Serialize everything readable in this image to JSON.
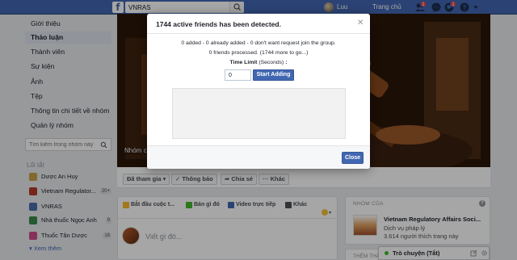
{
  "topbar": {
    "brand_color": "#4267b2",
    "logo_letter": "f",
    "search_value": "VNRAS",
    "user_name": "Luu",
    "home_label": "Trang chủ",
    "badges": {
      "friends": "1",
      "messages": "",
      "notifications": "1"
    }
  },
  "sidebar": {
    "items": [
      {
        "label": "Giới thiệu",
        "active": false
      },
      {
        "label": "Thảo luận",
        "active": true
      },
      {
        "label": "Thành viên",
        "active": false
      },
      {
        "label": "Sự kiện",
        "active": false
      },
      {
        "label": "Ảnh",
        "active": false
      },
      {
        "label": "Tệp",
        "active": false
      },
      {
        "label": "Thông tin chi tiết về nhóm",
        "active": false
      },
      {
        "label": "Quản lý nhóm",
        "active": false
      }
    ],
    "search_placeholder": "Tìm kiếm trong nhóm này",
    "shortcuts_heading": "Lối tắt",
    "shortcuts": [
      {
        "label": "Dược An Huy",
        "count": "",
        "color": "#c8a24a"
      },
      {
        "label": "Vietnam Regulator...",
        "count": "20+",
        "color": "#b43a2a"
      },
      {
        "label": "VNRAS",
        "count": "",
        "color": "#4a6ab0"
      },
      {
        "label": "Nhà thuốc Ngọc Anh",
        "count": "9",
        "color": "#3a8a4a"
      },
      {
        "label": "Thuốc Tân Dược",
        "count": "18",
        "color": "#d04a8a"
      }
    ],
    "see_more": "Xem thêm"
  },
  "cover": {
    "name_partial": "Nhóm c"
  },
  "action_bar": {
    "joined": "Đã tham gia",
    "notifications": "Thông báo",
    "share": "Chia sẻ",
    "more": "Khác"
  },
  "composer": {
    "tabs": [
      "Bắt đầu cuộc t...",
      "Bán gì đó",
      "Video trực tiếp",
      "Khác"
    ],
    "placeholder": "Viết gì đó..."
  },
  "right_panel": {
    "heading": "NHÓM CỦA",
    "group_title": "Vietnam Regulatory Affairs Soci...",
    "group_sub": "Dịch vụ pháp lý",
    "group_count": "3.614 người thích trang này",
    "heading2": "THÊM THÀNH"
  },
  "chat": {
    "label": "Trò chuyện (Tắt)"
  },
  "modal": {
    "title": "1744 active friends has been detected.",
    "status_line": "0 added - 0 already added - 0 don't want request join the group.",
    "processed_line": "0 friends processed. (1744 more to go...)",
    "time_limit_label": "Time Limit",
    "time_limit_unit": "(Seconds)",
    "time_limit_value": "0",
    "start_button": "Start Adding",
    "close_button": "Close"
  }
}
